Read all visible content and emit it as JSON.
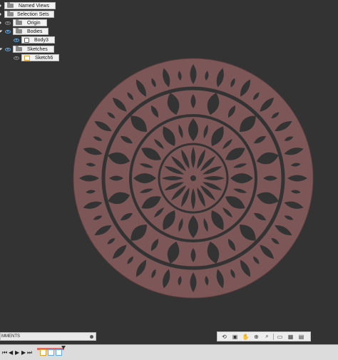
{
  "browser": {
    "named_views": "Named Views",
    "selection_sets": "Selection Sets",
    "origin": "Origin",
    "bodies": "Bodies",
    "body3": "Body3",
    "sketches": "Sketches",
    "sketch6": "Sketch6"
  },
  "comments": {
    "label": "MMENTS"
  },
  "colors": {
    "viewport": "#333333",
    "body": "#7d5757",
    "body_edge": "#5e3f3f"
  },
  "navbar": {
    "icons": [
      "orbit-icon",
      "look-at-icon",
      "pan-icon",
      "zoom-icon",
      "fit-icon",
      "display-settings-icon",
      "grid-icon",
      "viewports-icon"
    ]
  },
  "timeline": {
    "icons": [
      "go-start-icon",
      "step-back-icon",
      "play-icon",
      "step-forward-icon",
      "go-end-icon"
    ]
  }
}
